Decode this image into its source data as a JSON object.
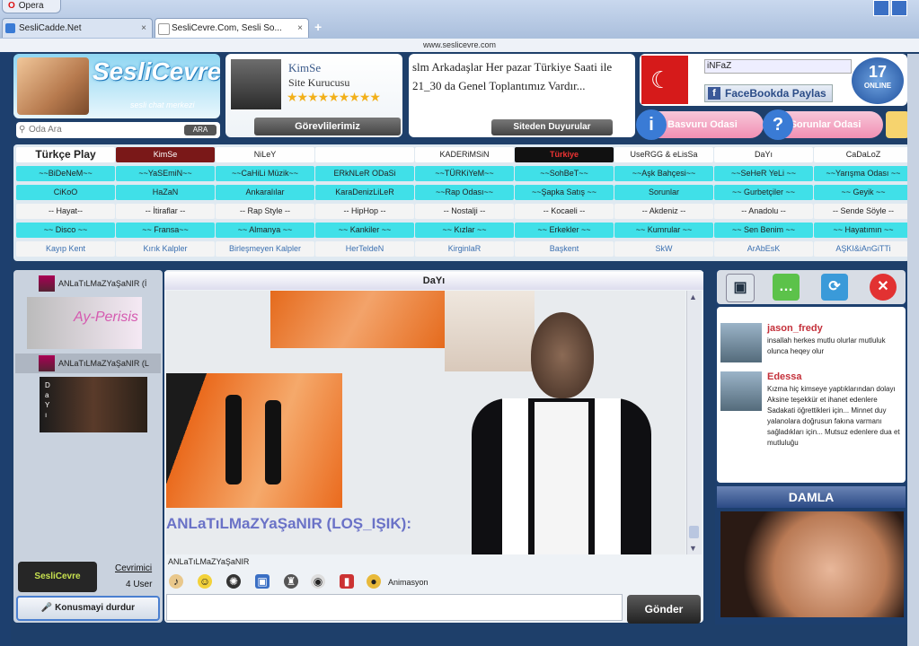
{
  "browser": {
    "menu_label": "Opera",
    "tabs": [
      {
        "label": "SesliCadde.Net"
      },
      {
        "label": "SesliCevre.Com, Sesli So..."
      }
    ],
    "new_tab_symbol": "+",
    "close_symbol": "×",
    "address": "www.seslicevre.com"
  },
  "header": {
    "logo_text": "SesliCevre",
    "logo_tagline": "sesli chat merkezi",
    "search_placeholder": "Oda Ara",
    "search_button": "ARA",
    "featured_name": "KimSe",
    "featured_role": "Site Kurucusu",
    "featured_stars": "★★★★★★★★★",
    "staff_button": "Görevlilerimiz",
    "announcement": "slm Arkadaşlar Her pazar Türkiye Saati ile 21_30 da Genel Toplantımız Vardır...",
    "announcement_button": "Siteden Duyurular",
    "user_name": "iNFaZ",
    "facebook_share": "FaceBookda Paylas",
    "online_count": "17",
    "online_label": "ONLINE",
    "apply_button": "Basvuru Odasi",
    "issues_button": "Sorunlar Odasi"
  },
  "rooms": [
    [
      "Türkçe Play",
      "KimSe",
      "NiLeY",
      "",
      "KADERiMSiN",
      "Türkiye",
      "UseRGG & eLisSa",
      "DaYı",
      "CaDaLoZ"
    ],
    [
      "~~BiDeNeM~~",
      "~~YaSEmiN~~",
      "~~CaHiLi Müzik~~",
      "ERkNLeR ODaSi",
      "~~TÜRKiYeM~~",
      "~~SohBeT~~",
      "~~Aşk Bahçesi~~",
      "~~SeHeR YeLi ~~",
      "~~Yarışma Odası ~~"
    ],
    [
      "CiKoO",
      "HaZaN",
      "Ankaralılar",
      "KaraDenizLiLeR",
      "~~Rap Odası~~",
      "~~Şapka Satış ~~",
      "Sorunlar",
      "~~ Gurbetçiler ~~",
      "~~ Geyik ~~"
    ],
    [
      "-- Hayat--",
      "-- İtiraflar --",
      "-- Rap Style --",
      "-- HipHop --",
      "-- Nostalji --",
      "-- Kocaeli --",
      "-- Akdeniz --",
      "-- Anadolu --",
      "-- Sende Söyle --"
    ],
    [
      "~~ Disco ~~",
      "~~ Fransa~~",
      "~~ Almanya ~~",
      "~~ Kankiler ~~",
      "~~ Kızlar ~~",
      "~~ Erkekler ~~",
      "~~ Kumrular ~~",
      "~~ Sen Benim ~~",
      "~~ Hayatımın ~~"
    ],
    [
      "Kayıp Kent",
      "Kırık Kalpler",
      "Birleşmeyen Kalpler",
      "HerTeldeN",
      "KirginlaR",
      "Başkent",
      "SkW",
      "ArAbEsK",
      "AŞKI&iAnGiTTi"
    ]
  ],
  "room_colors": [
    "#fefefe",
    "#40e0e8",
    "#40e0e8",
    "#f4f4f4",
    "#40e0e8",
    "#f4f4f4"
  ],
  "users": [
    {
      "name": "ANLaTıLMaZYaŞaNIR (İ"
    },
    {
      "name": "ANLaTıLMaZYaŞaNIR (L"
    }
  ],
  "tile1_text": "Ay-Perisis",
  "tile2_text": "D\na\nY\nı",
  "left_logo": "SesliCevre",
  "online_link": "Cevrimici",
  "user_count": "4 User",
  "stop_button": "Konusmayi durdur",
  "room": {
    "title": "DaYı",
    "stage_caption": "ANLaTıLMaZYaŞaNIR (LOŞ_IŞIK):",
    "speaker_label": "ANLaTıLMaZYaŞaNIR",
    "animation_label": "Animasyon",
    "send_button": "Gönder"
  },
  "emotes": [
    "speaker-icon",
    "smiley-icon",
    "bomb-icon",
    "frame-icon",
    "gift-icon",
    "eye-icon",
    "drink-icon",
    "bag-icon"
  ],
  "feed": [
    {
      "name": "jason_fredy",
      "text": "insallah herkes mutlu olurlar mutluluk olunca heqey olur"
    },
    {
      "name": "Edessa",
      "text": "Kızma hiç kimseye yaptıklarından dolayı Aksine teşekkür et ihanet edenlere Sadakati öğrettikleri için... Minnet duy yalanolara doğrusun fakına varmanı sağladıkları için... Mutsuz edenlere dua et mutluluğu"
    }
  ],
  "featured_user": "DAMLA",
  "colors": {
    "accent": "#40e0e8",
    "page_bg": "#1d3f6e",
    "name_red": "#c4303a"
  }
}
